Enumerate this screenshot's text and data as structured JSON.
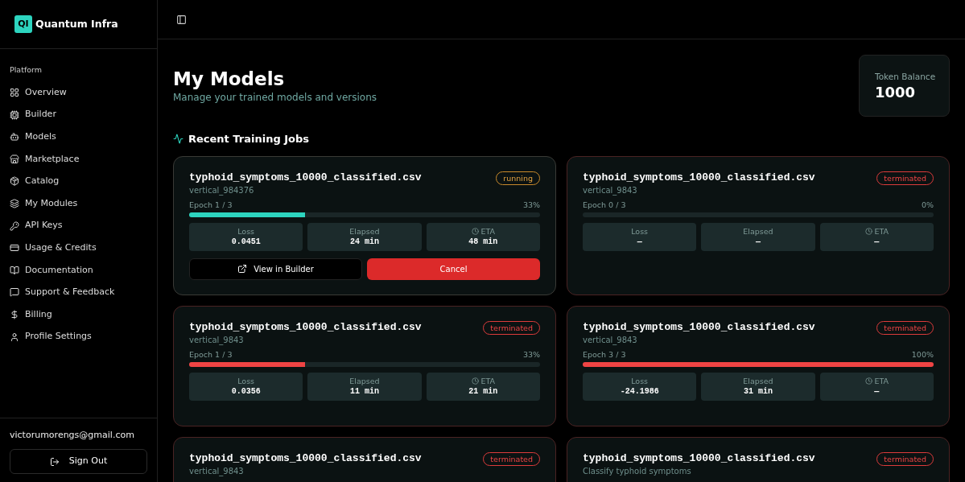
{
  "brand": {
    "logo_text": "QI",
    "name": "Quantum Infra"
  },
  "sidebar": {
    "section": "Platform",
    "items": [
      {
        "label": "Overview"
      },
      {
        "label": "Builder"
      },
      {
        "label": "Models"
      },
      {
        "label": "Marketplace"
      },
      {
        "label": "Catalog"
      },
      {
        "label": "My Modules"
      },
      {
        "label": "API Keys"
      },
      {
        "label": "Usage & Credits"
      },
      {
        "label": "Documentation"
      },
      {
        "label": "Support & Feedback"
      },
      {
        "label": "Billing"
      },
      {
        "label": "Profile Settings"
      }
    ],
    "email": "victorumorengs@gmail.com",
    "sign_out": "Sign Out"
  },
  "page": {
    "title": "My Models",
    "subtitle": "Manage your trained models and versions"
  },
  "token_balance": {
    "label": "Token Balance",
    "value": "1000"
  },
  "section_title": "Recent Training Jobs",
  "jobs": [
    {
      "name": "typhoid_symptoms_10000_classified.csv",
      "subtitle": "vertical_984376",
      "status": "running",
      "epoch": "Epoch 1 / 3",
      "percent": "33%",
      "level": 0.33,
      "stats": [
        {
          "label": "Loss",
          "value": "0.0451"
        },
        {
          "label": "Elapsed",
          "value": "24 min"
        },
        {
          "label": "ETA",
          "value": "48 min"
        }
      ],
      "actions": [
        {
          "label": "View in Builder",
          "kind": "secondary"
        },
        {
          "label": "Cancel",
          "kind": "danger"
        }
      ]
    },
    {
      "name": "typhoid_symptoms_10000_classified.csv",
      "subtitle": "vertical_9843",
      "status": "terminated",
      "epoch": "Epoch 0 / 3",
      "percent": "0%",
      "level": 0,
      "stats": [
        {
          "label": "Loss",
          "value": "—"
        },
        {
          "label": "Elapsed",
          "value": "—"
        },
        {
          "label": "ETA",
          "value": "—"
        }
      ]
    },
    {
      "name": "typhoid_symptoms_10000_classified.csv",
      "subtitle": "vertical_9843",
      "status": "terminated",
      "epoch": "Epoch 1 / 3",
      "percent": "33%",
      "level": 0.33,
      "stats": [
        {
          "label": "Loss",
          "value": "0.0356"
        },
        {
          "label": "Elapsed",
          "value": "11 min"
        },
        {
          "label": "ETA",
          "value": "21 min"
        }
      ]
    },
    {
      "name": "typhoid_symptoms_10000_classified.csv",
      "subtitle": "vertical_9843",
      "status": "terminated",
      "epoch": "Epoch 3 / 3",
      "percent": "100%",
      "level": 1,
      "stats": [
        {
          "label": "Loss",
          "value": "-24.1986"
        },
        {
          "label": "Elapsed",
          "value": "31 min"
        },
        {
          "label": "ETA",
          "value": "—"
        }
      ]
    },
    {
      "name": "typhoid_symptoms_10000_classified.csv",
      "subtitle": "vertical_9843",
      "status": "terminated"
    },
    {
      "name": "typhoid_symptoms_10000_classified.csv",
      "subtitle": "Classify typhoid symptoms",
      "status": "terminated"
    }
  ]
}
